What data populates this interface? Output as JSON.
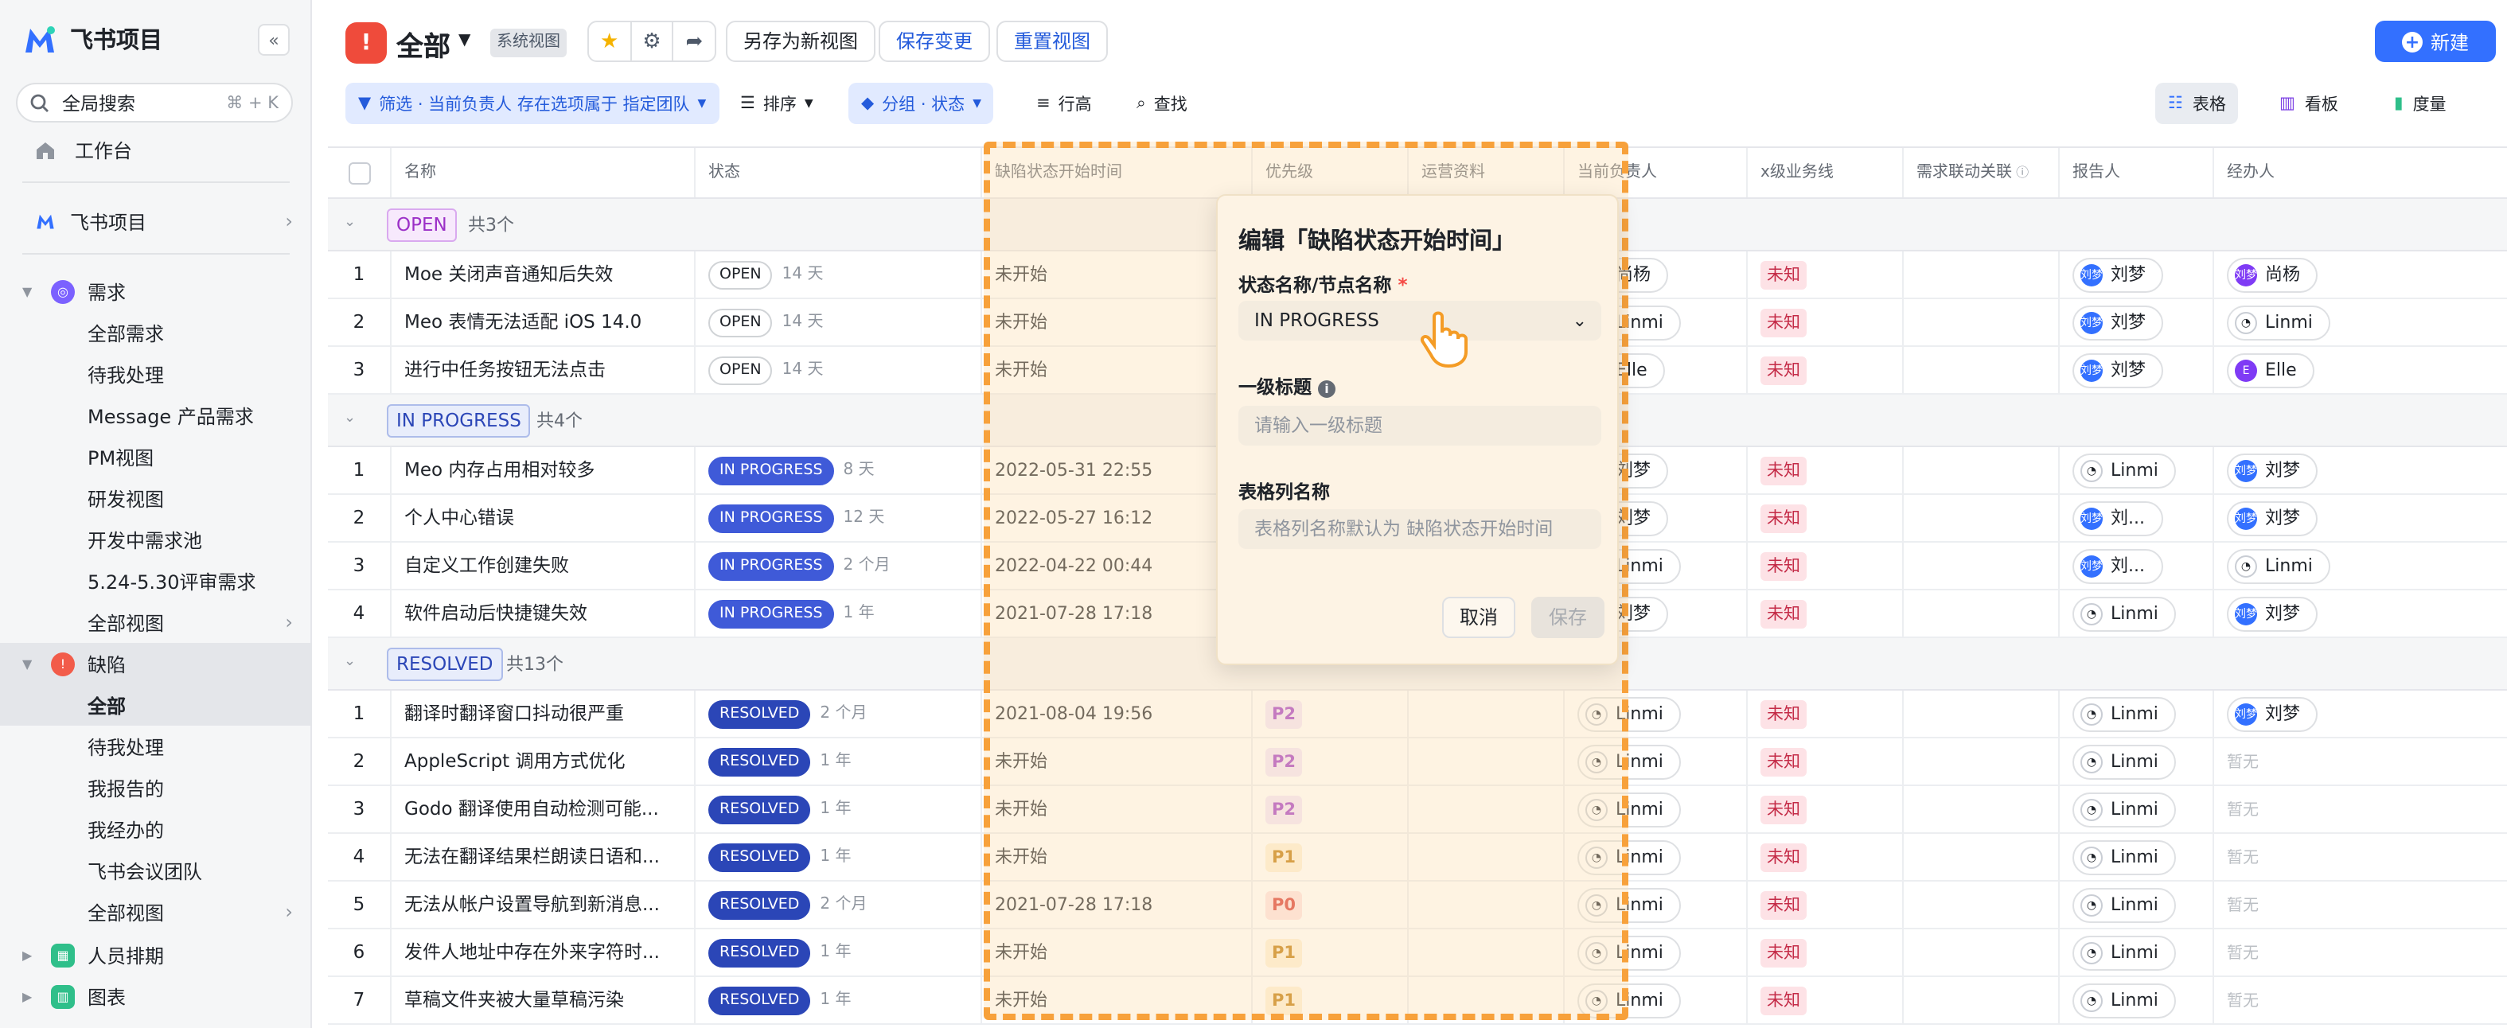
{
  "app": {
    "title": "飞书项目",
    "collapse_icon": "double-chevron-left-icon"
  },
  "sidebar": {
    "search": {
      "placeholder": "全局搜索",
      "shortcut": "⌘ + K"
    },
    "workbench": "工作台",
    "project": "飞书项目",
    "sections": [
      {
        "label": "需求",
        "color": "#7b61ff",
        "items": [
          "全部需求",
          "待我处理",
          "Message 产品需求",
          "PM视图",
          "研发视图",
          "开发中需求池",
          "5.24-5.30评审需求",
          "全部视图"
        ]
      },
      {
        "label": "缺陷",
        "color": "#f25c4a",
        "items": [
          "全部",
          "待我处理",
          "我报告的",
          "我经办的",
          "飞书会议团队",
          "全部视图"
        ]
      },
      {
        "label": "人员排期",
        "color": "#2fbf8a"
      },
      {
        "label": "图表",
        "color": "#2fbf8a"
      }
    ]
  },
  "view": {
    "title": "全部",
    "badge": "系统视图",
    "save_as": "另存为新视图",
    "save_changes": "保存变更",
    "reset": "重置视图",
    "new_btn": "新建"
  },
  "toolbar": {
    "filter": "筛选 · 当前负责人 存在选项属于 指定团队",
    "sort": "排序",
    "group": "分组 · 状态",
    "row_height": "行高",
    "find": "查找",
    "views": [
      "表格",
      "看板",
      "度量"
    ]
  },
  "columns": [
    "名称",
    "状态",
    "缺陷状态开始时间",
    "优先级",
    "运营资料",
    "当前负责人",
    "x级业务线",
    "需求联动关联",
    "报告人",
    "经办人"
  ],
  "groups": [
    {
      "name": "OPEN",
      "count": "共3个",
      "rows": [
        {
          "n": "1",
          "name": "Moe 关闭声音通知后失效",
          "status": "OPEN",
          "age": "14 天",
          "start": "未开始",
          "prio": "",
          "owner": "尚杨",
          "biz": "未知",
          "reporter": "刘梦",
          "handler": "尚杨"
        },
        {
          "n": "2",
          "name": "Meo 表情无法适配 iOS 14.0",
          "status": "OPEN",
          "age": "14 天",
          "start": "未开始",
          "prio": "",
          "owner": "Linmi",
          "biz": "未知",
          "reporter": "刘梦",
          "handler": "Linmi"
        },
        {
          "n": "3",
          "name": "进行中任务按钮无法点击",
          "status": "OPEN",
          "age": "14 天",
          "start": "未开始",
          "prio": "",
          "owner": "Elle",
          "biz": "未知",
          "reporter": "刘梦",
          "handler": "Elle"
        }
      ]
    },
    {
      "name": "IN PROGRESS",
      "count": "共4个",
      "rows": [
        {
          "n": "1",
          "name": "Meo 内存占用相对较多",
          "status": "IN PROGRESS",
          "age": "8 天",
          "start": "2022-05-31 22:55",
          "prio": "",
          "owner": "刘梦",
          "biz": "未知",
          "reporter": "Linmi",
          "handler": "刘梦"
        },
        {
          "n": "2",
          "name": "个人中心错误",
          "status": "IN PROGRESS",
          "age": "12 天",
          "start": "2022-05-27 16:12",
          "prio": "",
          "owner": "刘梦",
          "biz": "未知",
          "reporter": "刘...",
          "handler": "刘梦"
        },
        {
          "n": "3",
          "name": "自定义工作创建失败",
          "status": "IN PROGRESS",
          "age": "2 个月",
          "start": "2022-04-22 00:44",
          "prio": "",
          "owner": "Linmi",
          "biz": "未知",
          "reporter": "刘...",
          "handler": "Linmi"
        },
        {
          "n": "4",
          "name": "软件启动后快捷键失效",
          "status": "IN PROGRESS",
          "age": "1 年",
          "start": "2021-07-28 17:18",
          "prio": "",
          "owner": "刘梦",
          "biz": "未知",
          "reporter": "Linmi",
          "handler": "刘梦"
        }
      ]
    },
    {
      "name": "RESOLVED",
      "count": "共13个",
      "rows": [
        {
          "n": "1",
          "name": "翻译时翻译窗口抖动很严重",
          "status": "RESOLVED",
          "age": "2 个月",
          "start": "2021-08-04 19:56",
          "prio": "P2",
          "owner": "Linmi",
          "biz": "未知",
          "reporter": "Linmi",
          "handler": "刘梦"
        },
        {
          "n": "2",
          "name": "AppleScript 调用方式优化",
          "status": "RESOLVED",
          "age": "1 年",
          "start": "未开始",
          "prio": "P2",
          "owner": "Linmi",
          "biz": "未知",
          "reporter": "Linmi",
          "handler": "暂无"
        },
        {
          "n": "3",
          "name": "Godo 翻译使用自动检测可能...",
          "status": "RESOLVED",
          "age": "1 年",
          "start": "未开始",
          "prio": "P2",
          "owner": "Linmi",
          "biz": "未知",
          "reporter": "Linmi",
          "handler": "暂无"
        },
        {
          "n": "4",
          "name": "无法在翻译结果栏朗读日语和...",
          "status": "RESOLVED",
          "age": "1 年",
          "start": "未开始",
          "prio": "P1",
          "owner": "Linmi",
          "biz": "未知",
          "reporter": "Linmi",
          "handler": "暂无"
        },
        {
          "n": "5",
          "name": "无法从帐户设置导航到新消息...",
          "status": "RESOLVED",
          "age": "2 个月",
          "start": "2021-07-28 17:18",
          "prio": "P0",
          "owner": "Linmi",
          "biz": "未知",
          "reporter": "Linmi",
          "handler": "暂无"
        },
        {
          "n": "6",
          "name": "发件人地址中存在外来字符时...",
          "status": "RESOLVED",
          "age": "1 年",
          "start": "未开始",
          "prio": "P1",
          "owner": "Linmi",
          "biz": "未知",
          "reporter": "Linmi",
          "handler": "暂无"
        },
        {
          "n": "7",
          "name": "草稿文件夹被大量草稿污染",
          "status": "RESOLVED",
          "age": "1 年",
          "start": "未开始",
          "prio": "P1",
          "owner": "Linmi",
          "biz": "未知",
          "reporter": "Linmi",
          "handler": "暂无"
        }
      ]
    }
  ],
  "popup": {
    "title": "编辑「缺陷状态开始时间」",
    "status_label": "状态名称/节点名称",
    "required": "*",
    "status_value": "IN PROGRESS",
    "heading_label": "一级标题",
    "heading_placeholder": "请输入一级标题",
    "colname_label": "表格列名称",
    "colname_placeholder": "表格列名称默认为 缺陷状态开始时间",
    "cancel": "取消",
    "save": "保存"
  },
  "avatar_badge": "刘梦"
}
